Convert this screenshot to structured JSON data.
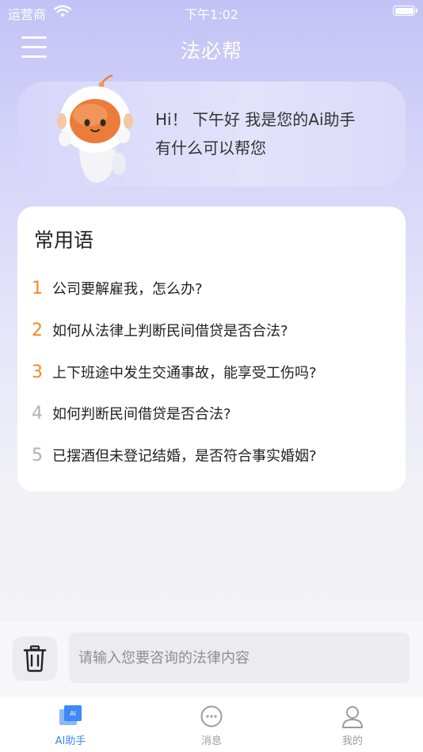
{
  "status_bar": {
    "carrier": "运营商",
    "time": "下午1:02"
  },
  "header": {
    "title": "法必帮",
    "menu_icon": "hamburger-menu-icon"
  },
  "greeting": {
    "line1": "Hi！ 下午好 我是您的Ai助手",
    "line2": "有什么可以帮您"
  },
  "phrases": {
    "title": "常用语",
    "items": [
      {
        "num": "1",
        "text": "公司要解雇我，怎么办?",
        "highlight": true
      },
      {
        "num": "2",
        "text": "如何从法律上判断民间借贷是否合法?",
        "highlight": true
      },
      {
        "num": "3",
        "text": "上下班途中发生交通事故，能享受工伤吗?",
        "highlight": true
      },
      {
        "num": "4",
        "text": "如何判断民间借贷是否合法?",
        "highlight": false
      },
      {
        "num": "5",
        "text": "已摆酒但未登记结婚，是否符合事实婚姻?",
        "highlight": false
      }
    ]
  },
  "input_bar": {
    "placeholder": "请输入您要咨询的法律内容",
    "trash_icon": "trash-icon"
  },
  "tabs": [
    {
      "label": "AI助手",
      "icon": "ai-assistant-icon",
      "active": true
    },
    {
      "label": "消息",
      "icon": "message-bubble-icon",
      "active": false
    },
    {
      "label": "我的",
      "icon": "person-icon",
      "active": false
    }
  ],
  "colors": {
    "accent": "#3d8af7",
    "number_highlight": "#f08a2a",
    "number_muted": "#b2b2b6"
  }
}
